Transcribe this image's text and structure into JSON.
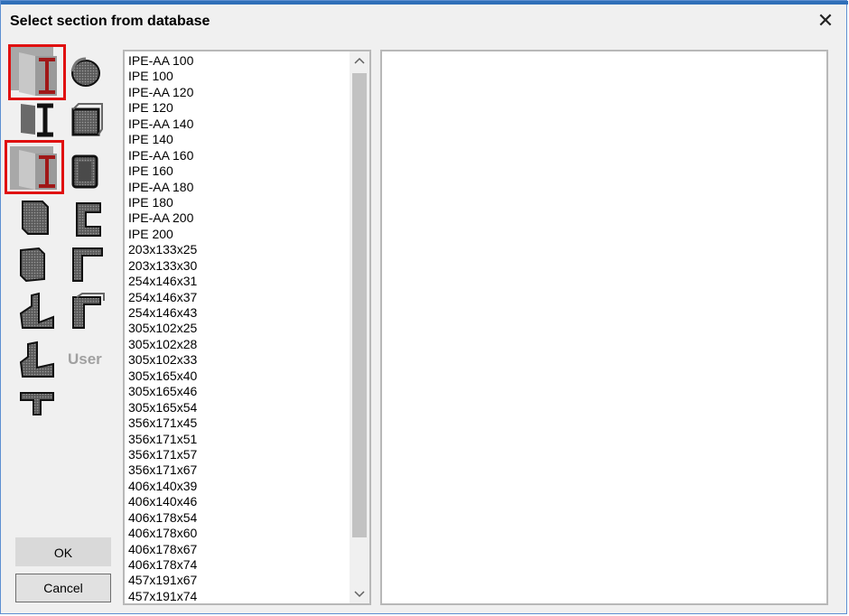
{
  "dialog": {
    "title": "Select section from database",
    "close_glyph": "✕"
  },
  "shape_palette": {
    "items": [
      {
        "name": "i-beam-section-icon",
        "selected": true
      },
      {
        "name": "circular-hollow-section-icon",
        "selected": false
      },
      {
        "name": "wide-flange-section-icon",
        "selected": false
      },
      {
        "name": "square-hollow-section-icon",
        "selected": false
      },
      {
        "name": "i-beam-section-alt-icon",
        "selected": true
      },
      {
        "name": "rectangular-hollow-section-icon",
        "selected": false
      },
      {
        "name": "solid-rectangle-section-icon",
        "selected": false
      },
      {
        "name": "channel-section-icon",
        "selected": false
      },
      {
        "name": "solid-block-section-icon",
        "selected": false
      },
      {
        "name": "lipped-channel-section-icon",
        "selected": false
      },
      {
        "name": "angle-section-icon",
        "selected": false
      },
      {
        "name": "cold-formed-channel-section-icon",
        "selected": false
      },
      {
        "name": "unequal-angle-section-icon",
        "selected": false
      },
      {
        "name": "tee-section-icon",
        "selected": false
      }
    ],
    "user_label": "User"
  },
  "section_list": {
    "items": [
      "IPE-AA 100",
      "IPE 100",
      "IPE-AA 120",
      "IPE 120",
      "IPE-AA 140",
      "IPE 140",
      "IPE-AA 160",
      "IPE 160",
      "IPE-AA 180",
      "IPE 180",
      "IPE-AA 200",
      "IPE 200",
      "203x133x25",
      "203x133x30",
      "254x146x31",
      "254x146x37",
      "254x146x43",
      "305x102x25",
      "305x102x28",
      "305x102x33",
      "305x165x40",
      "305x165x46",
      "305x165x54",
      "356x171x45",
      "356x171x51",
      "356x171x57",
      "356x171x67",
      "406x140x39",
      "406x140x46",
      "406x178x54",
      "406x178x60",
      "406x178x67",
      "406x178x74",
      "457x191x67",
      "457x191x74"
    ]
  },
  "buttons": {
    "ok": "OK",
    "cancel": "Cancel"
  },
  "colors": {
    "selection_border": "#e01010",
    "title_accent": "#2f6fb8",
    "beam_red": "#a01818"
  }
}
